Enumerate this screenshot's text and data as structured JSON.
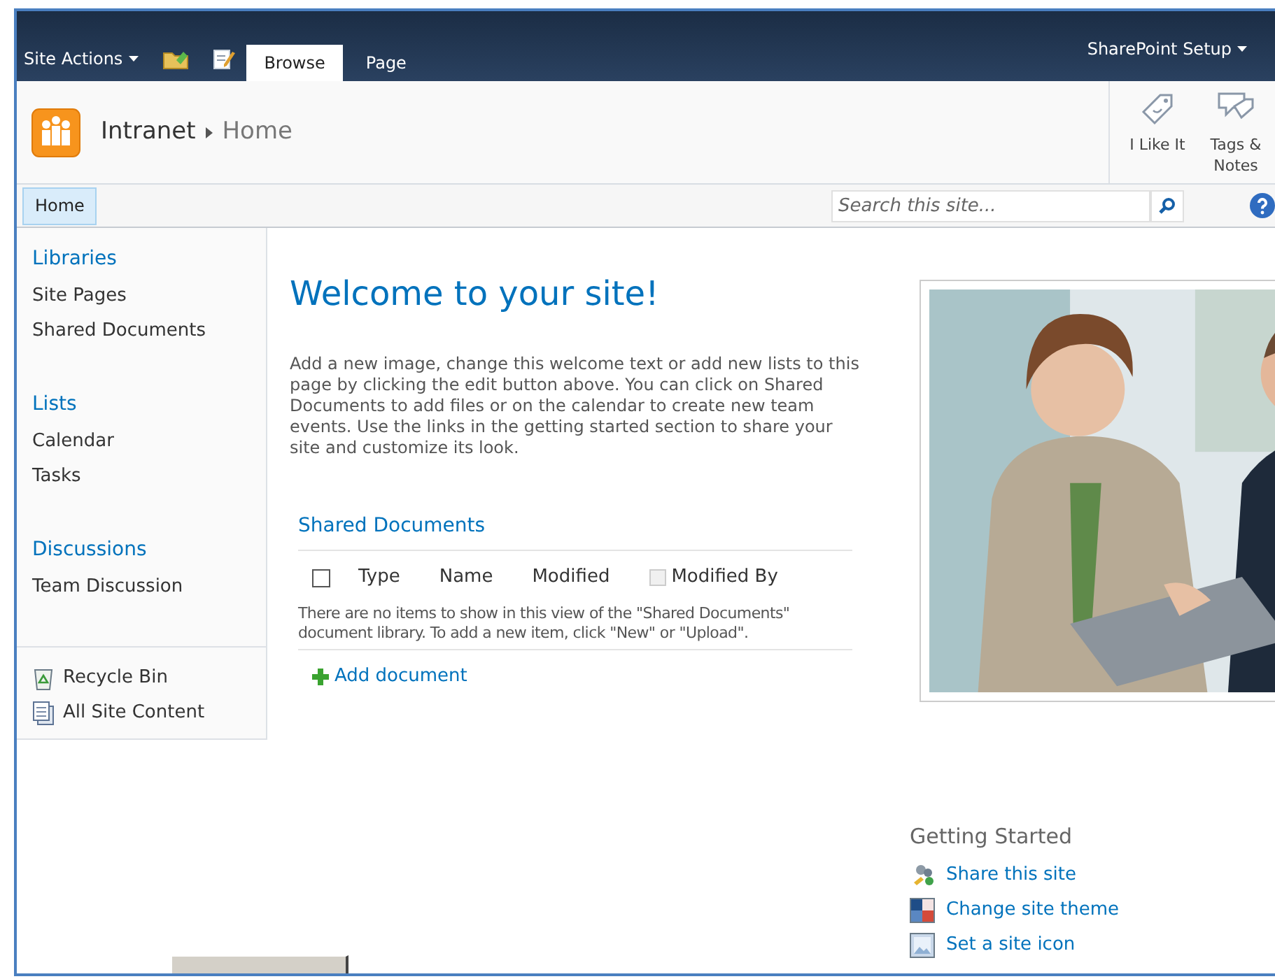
{
  "top_bar": {
    "site_actions": "Site Actions",
    "tabs": [
      {
        "label": "Browse",
        "selected": true
      },
      {
        "label": "Page",
        "selected": false
      }
    ],
    "user_menu": "SharePoint Setup"
  },
  "title_area": {
    "site": "Intranet",
    "page": "Home",
    "actions": [
      {
        "label": "I Like It",
        "kind": "like"
      },
      {
        "label": "Tags & Notes",
        "kind": "tags"
      }
    ]
  },
  "nav": {
    "tabs": [
      {
        "label": "Home",
        "selected": true
      }
    ],
    "search": {
      "placeholder": "Search this site..."
    }
  },
  "sidebar": {
    "sections": [
      {
        "heading": "Libraries",
        "items": [
          "Site Pages",
          "Shared Documents"
        ]
      },
      {
        "heading": "Lists",
        "items": [
          "Calendar",
          "Tasks"
        ]
      },
      {
        "heading": "Discussions",
        "items": [
          "Team Discussion"
        ]
      }
    ],
    "footer_links": [
      {
        "label": "Recycle Bin",
        "kind": "recycle"
      },
      {
        "label": "All Site Content",
        "kind": "content"
      }
    ]
  },
  "main": {
    "title": "Welcome to your site!",
    "intro": "Add a new image, change this welcome text or add new lists to this page by clicking the edit button above. You can click on Shared Documents to add files or on the calendar to create new team events. Use the links in the getting started section to share your site and customize its look.",
    "web_part": {
      "title": "Shared Documents",
      "select_all": {
        "checked": false
      },
      "columns": [
        {
          "label": "Type",
          "kind": "text"
        },
        {
          "label": "Name",
          "kind": "text"
        },
        {
          "label": "Modified",
          "kind": "text"
        },
        {
          "label": "Modified By",
          "kind": "icon"
        }
      ],
      "empty_message": "There are no items to show in this view of the \"Shared Documents\" document library. To add a new item, click \"New\" or \"Upload\".",
      "add_link": "Add document"
    }
  },
  "getting_started": {
    "title": "Getting Started",
    "links": [
      {
        "label": "Share this site",
        "kind": "share"
      },
      {
        "label": "Change site theme",
        "kind": "theme"
      },
      {
        "label": "Set a site icon",
        "kind": "icon"
      }
    ]
  }
}
